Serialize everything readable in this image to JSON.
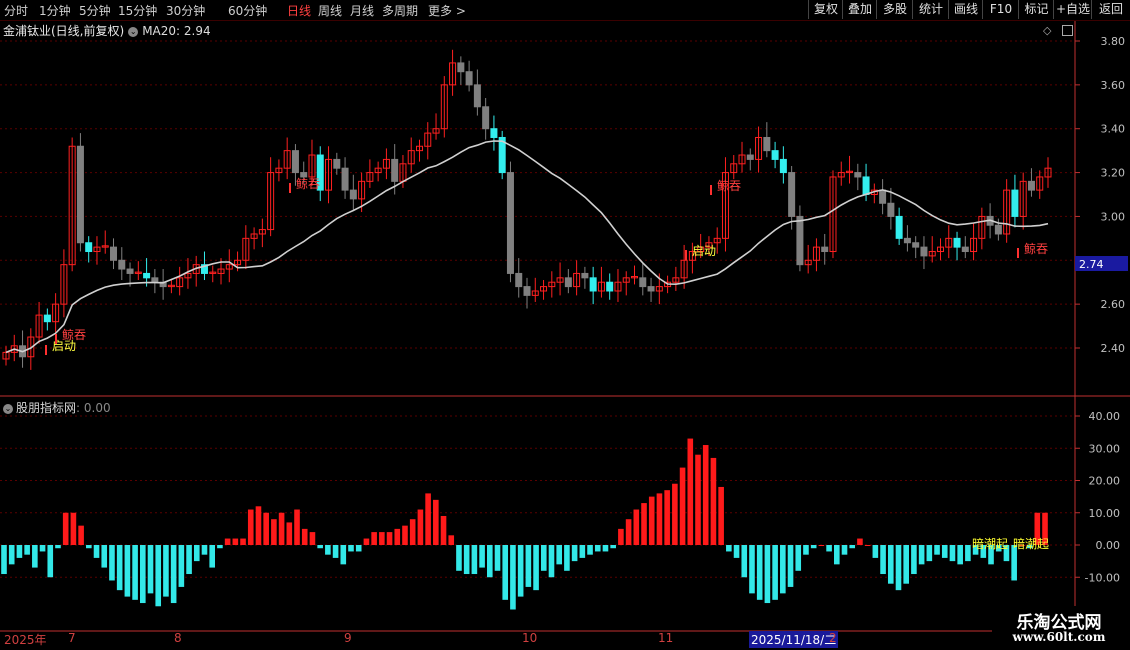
{
  "toolbar": {
    "periods": [
      "分时",
      "1分钟",
      "5分钟",
      "15分钟",
      "30分钟",
      "60分钟",
      "日线",
      "周线",
      "月线",
      "多周期",
      "更多 >"
    ],
    "active": "日线",
    "right_buttons": [
      "复权",
      "叠加",
      "多股",
      "统计",
      "画线",
      "F10",
      "标记",
      "+自选",
      "返回"
    ]
  },
  "stock": {
    "name": "金浦钛业(日线,前复权)",
    "ma_label": "MA20: 2.94"
  },
  "indicator": {
    "name": "股朋指标网",
    "value": ": 0.00"
  },
  "watermark": {
    "line1": "乐淘公式网",
    "line2": "www.60lt.com"
  },
  "dates": {
    "year": "2025年",
    "m7": "7",
    "m8": "8",
    "m9": "9",
    "m10": "10",
    "m11": "11",
    "selected": "2025/11/18/二",
    "m12": "2"
  },
  "labels": {
    "qidong": "启动",
    "tuntun": "鲸吞",
    "xiaoxi": "鲸吞",
    "anchao": "暗潮起"
  },
  "price_badge": "2.74",
  "colors": {
    "up": "#ff2020",
    "down_gray": "#808080",
    "cyan": "#33eeee",
    "ma": "#d0d0d0",
    "grid": "#5a0000",
    "axis": "#c03030"
  },
  "chart_data": [
    {
      "type": "candlestick",
      "title": "金浦钛业(日线,前复权)",
      "ylim": [
        2.25,
        3.85
      ],
      "y_ticks": [
        "3.80",
        "3.60",
        "3.40",
        "3.20",
        "3.00",
        "2.80",
        "2.60",
        "2.40"
      ],
      "ma20_last": 2.94,
      "approx_close_series": [
        2.38,
        2.41,
        2.36,
        2.45,
        2.55,
        2.52,
        2.6,
        2.78,
        3.32,
        2.88,
        2.84,
        2.86,
        2.86,
        2.8,
        2.76,
        2.74,
        2.74,
        2.72,
        2.7,
        2.68,
        2.68,
        2.72,
        2.74,
        2.78,
        2.74,
        2.74,
        2.76,
        2.78,
        2.8,
        2.9,
        2.92,
        2.94,
        3.2,
        3.22,
        3.3,
        3.2,
        3.18,
        3.28,
        3.12,
        3.26,
        3.22,
        3.12,
        3.08,
        3.16,
        3.2,
        3.22,
        3.26,
        3.16,
        3.24,
        3.3,
        3.32,
        3.38,
        3.4,
        3.6,
        3.7,
        3.66,
        3.6,
        3.5,
        3.4,
        3.36,
        3.2,
        2.74,
        2.68,
        2.64,
        2.66,
        2.68,
        2.7,
        2.72,
        2.68,
        2.74,
        2.72,
        2.66,
        2.7,
        2.66,
        2.7,
        2.72,
        2.72,
        2.68,
        2.66,
        2.68,
        2.7,
        2.72,
        2.8,
        2.84,
        2.86,
        2.88,
        2.9,
        3.2,
        3.24,
        3.28,
        3.26,
        3.36,
        3.3,
        3.26,
        3.2,
        3.0,
        2.78,
        2.8,
        2.86,
        2.84,
        3.18,
        3.2,
        3.2,
        3.18,
        3.1,
        3.12,
        3.06,
        3.0,
        2.9,
        2.88,
        2.86,
        2.82,
        2.84,
        2.86,
        2.9,
        2.86,
        2.84,
        2.9,
        3.0,
        2.96,
        2.92,
        3.12,
        3.0,
        3.16,
        3.12,
        3.18,
        3.22
      ],
      "labels": [
        "启动",
        "鲸吞",
        "鲸吞",
        "鲸吞",
        "启动",
        "鲸吞"
      ]
    },
    {
      "type": "bar",
      "title": "股朋指标网",
      "ylim": [
        -15,
        45
      ],
      "y_ticks": [
        "40.00",
        "30.00",
        "20.00",
        "10.00",
        "0.00",
        "-10.00"
      ],
      "values": [
        -9,
        -6,
        -4,
        -3,
        -7,
        -2,
        -10,
        -1,
        10,
        10,
        6,
        -1,
        -4,
        -7,
        -11,
        -14,
        -16,
        -17,
        -18,
        -15,
        -19,
        -16,
        -18,
        -13,
        -9,
        -5,
        -3,
        -7,
        -1,
        2,
        2,
        2,
        11,
        12,
        10,
        8,
        10,
        7,
        11,
        5,
        4,
        -1,
        -3,
        -4,
        -6,
        -2,
        -2,
        2,
        4,
        4,
        4,
        5,
        6,
        8,
        11,
        16,
        14,
        9,
        3,
        -8,
        -9,
        -9,
        -7,
        -10,
        -8,
        -17,
        -20,
        -16,
        -13,
        -14,
        -8,
        -10,
        -6,
        -8,
        -5,
        -4,
        -3,
        -2,
        -2,
        -1,
        5,
        8,
        11,
        13,
        15,
        16,
        17,
        19,
        24,
        33,
        28,
        31,
        27,
        18,
        -2,
        -4,
        -10,
        -15,
        -17,
        -18,
        -17,
        -15,
        -13,
        -8,
        -3,
        -1,
        0,
        -2,
        -6,
        -3,
        -1,
        2,
        0,
        -4,
        -9,
        -12,
        -14,
        -12,
        -9,
        -6,
        -5,
        -3,
        -4,
        -5,
        -6,
        -5,
        -3,
        -4,
        -6,
        -2,
        -5,
        -11,
        0,
        -1,
        10,
        10
      ],
      "annotations": [
        "暗潮起",
        "暗潮起"
      ]
    }
  ]
}
